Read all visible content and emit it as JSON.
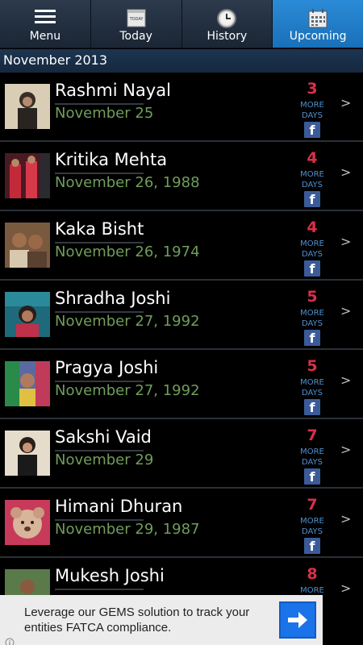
{
  "tabs": [
    {
      "label": "Menu",
      "icon": "hamburger-icon"
    },
    {
      "label": "Today",
      "icon": "today-calendar-icon",
      "icon_text": "TODAY"
    },
    {
      "label": "History",
      "icon": "history-clock-icon"
    },
    {
      "label": "Upcoming",
      "icon": "upcoming-calendar-icon"
    }
  ],
  "active_tab": "Upcoming",
  "month_header": "November 2013",
  "more_label_1": "MORE",
  "more_label_2": "DAYS",
  "fb_glyph": "f",
  "chevron": ">",
  "birthdays": [
    {
      "name": "Rashmi Nayal",
      "date": "November 25",
      "days": "3"
    },
    {
      "name": "Kritika Mehta",
      "date": "November 26, 1988",
      "days": "4"
    },
    {
      "name": "Kaka Bisht",
      "date": "November 26, 1974",
      "days": "4"
    },
    {
      "name": "Shradha Joshi",
      "date": "November 27, 1992",
      "days": "5"
    },
    {
      "name": "Pragya Joshi",
      "date": "November 27, 1992",
      "days": "5"
    },
    {
      "name": "Sakshi Vaid",
      "date": "November 29",
      "days": "7"
    },
    {
      "name": "Himani Dhuran",
      "date": "November 29, 1987",
      "days": "7"
    },
    {
      "name": "Mukesh Joshi",
      "date": "",
      "days": "8"
    }
  ],
  "ad": {
    "text": "Leverage our GEMS solution to track your entities FATCA compliance."
  },
  "colors": {
    "active_tab": "#1f7cc6",
    "date_green": "#6f9e5a",
    "days_red": "#d9304a",
    "more_blue": "#4f90d0",
    "facebook_blue": "#3b5b98"
  }
}
